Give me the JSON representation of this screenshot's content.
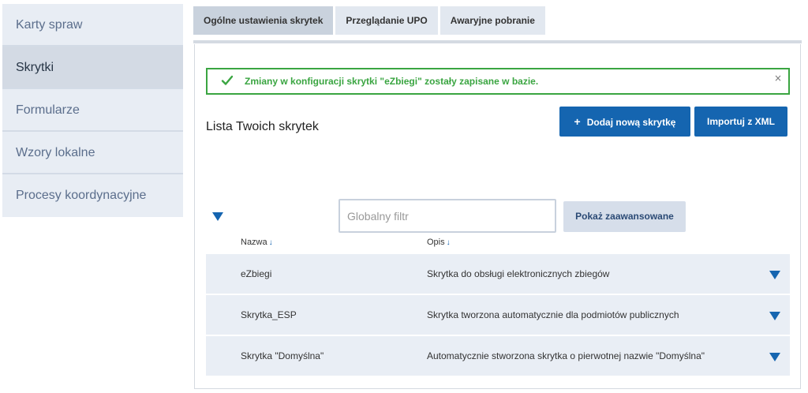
{
  "sidebar": {
    "items": [
      {
        "label": "Karty spraw",
        "active": false
      },
      {
        "label": "Skrytki",
        "active": true
      },
      {
        "label": "Formularze",
        "active": false
      },
      {
        "label": "Wzory lokalne",
        "active": false
      },
      {
        "label": "Procesy koordynacyjne",
        "active": false
      }
    ]
  },
  "tabs": [
    {
      "label": "Ogólne ustawienia skrytek",
      "active": true
    },
    {
      "label": "Przeglądanie UPO",
      "active": false
    },
    {
      "label": "Awaryjne pobranie",
      "active": false
    }
  ],
  "alert": {
    "message": "Zmiany w konfiguracji skrytki \"eZbiegi\" zostały zapisane w bazie.",
    "close": "×",
    "icon": "check-icon",
    "color": "#3aa541"
  },
  "list": {
    "title": "Lista Twoich skrytek",
    "add_button": {
      "icon": "+",
      "label": "Dodaj nową skrytkę"
    },
    "import_button": "Importuj z XML"
  },
  "filter": {
    "placeholder": "Globalny filtr",
    "value": "",
    "advanced_button": "Pokaż zaawansowane"
  },
  "table": {
    "columns": [
      {
        "label": "Nazwa",
        "sort": "↓"
      },
      {
        "label": "Opis",
        "sort": "↓"
      }
    ],
    "rows": [
      {
        "name": "eZbiegi",
        "description": "Skrytka do obsługi elektronicznych zbiegów"
      },
      {
        "name": "Skrytka_ESP",
        "description": "Skrytka tworzona automatycznie dla podmiotów publicznych"
      },
      {
        "name": "Skrytka \"Domyślna\"",
        "description": "Automatycznie stworzona skrytka o pierwotnej nazwie \"Domyślna\""
      }
    ]
  },
  "colors": {
    "primary": "#1565b0",
    "success": "#3aa541",
    "sidebar_bg": "#e8edf4",
    "row_bg": "#e9eef5"
  }
}
